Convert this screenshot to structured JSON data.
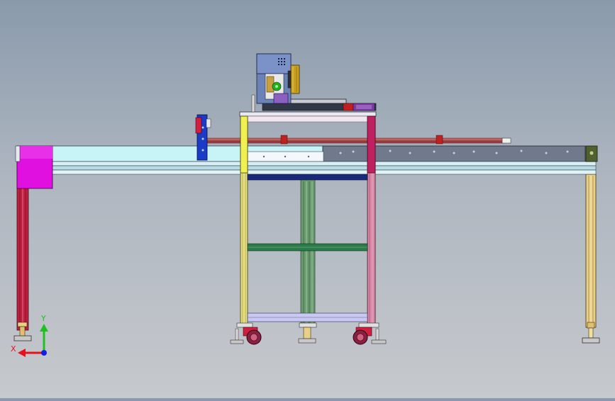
{
  "viewport": {
    "background_top": "#8a9aac",
    "background_bottom": "#c6c9cd"
  },
  "triad": {
    "x_label": "X",
    "y_label": "Y",
    "x_color": "#e8101a",
    "y_color": "#20c020",
    "z_color": "#1020e0"
  },
  "colors": {
    "frame_yellow": "#e8e080",
    "frame_pink": "#d88aa8",
    "magenta_block": "#e010e0",
    "conveyor_cyan": "#c8f4f8",
    "conveyor_gray": "#707a8c",
    "leg_red": "#c02040",
    "leg_tan": "#e8d088",
    "tool_head": "#6a82b8",
    "green_crossbar": "#2a7a4a",
    "navy": "#1a2a7a",
    "lavender": "#c8c8f0"
  }
}
